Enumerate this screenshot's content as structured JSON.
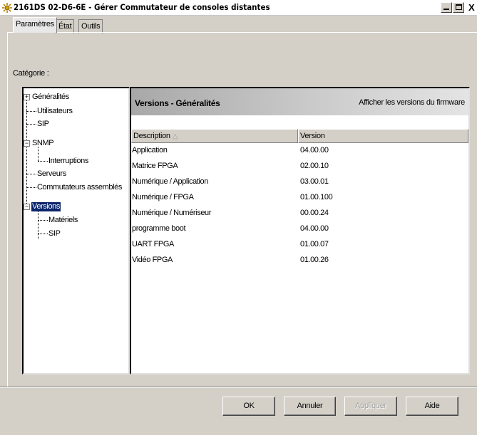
{
  "window": {
    "title": "2161DS 02-D6-6E - Gérer Commutateur de consoles distantes",
    "icon": "switch-app-icon",
    "close_glyph": "X"
  },
  "tabs": [
    {
      "label": "Paramètres",
      "active": true
    },
    {
      "label": "État",
      "active": false
    },
    {
      "label": "Outils",
      "active": false
    }
  ],
  "category_label": "Catégorie :",
  "tree": {
    "items": [
      {
        "label": "Généralités",
        "expander": "+"
      },
      {
        "label": "Utilisateurs"
      },
      {
        "label": "SIP"
      },
      {
        "label": "SNMP",
        "expander": "−"
      },
      {
        "label": "Interruptions"
      },
      {
        "label": "Serveurs"
      },
      {
        "label": "Commutateurs assemblés"
      },
      {
        "label": "Versions",
        "expander": "−",
        "selected": true
      },
      {
        "label": "Matériels"
      },
      {
        "label": "SIP"
      }
    ]
  },
  "panel": {
    "title": "Versions - Généralités",
    "link": "Afficher les versions du firmware"
  },
  "table": {
    "columns": [
      "Description",
      "Version"
    ],
    "sort_indicator": "△",
    "rows": [
      [
        "Application",
        "04.00.00"
      ],
      [
        "Matrice FPGA",
        "02.00.10"
      ],
      [
        "Numérique / Application",
        "03.00.01"
      ],
      [
        "Numérique / FPGA",
        "01.00.100"
      ],
      [
        "Numérique / Numériseur",
        "00.00.24"
      ],
      [
        "programme boot",
        "04.00.00"
      ],
      [
        "UART FPGA",
        "01.00.07"
      ],
      [
        "Vidéo FPGA",
        "01.00.26"
      ]
    ]
  },
  "buttons": {
    "ok": "OK",
    "cancel": "Annuler",
    "apply": "Appliquer",
    "help": "Aide"
  },
  "colors": {
    "selection": "#0a246a",
    "dialog_bg": "#d4d0c8"
  }
}
